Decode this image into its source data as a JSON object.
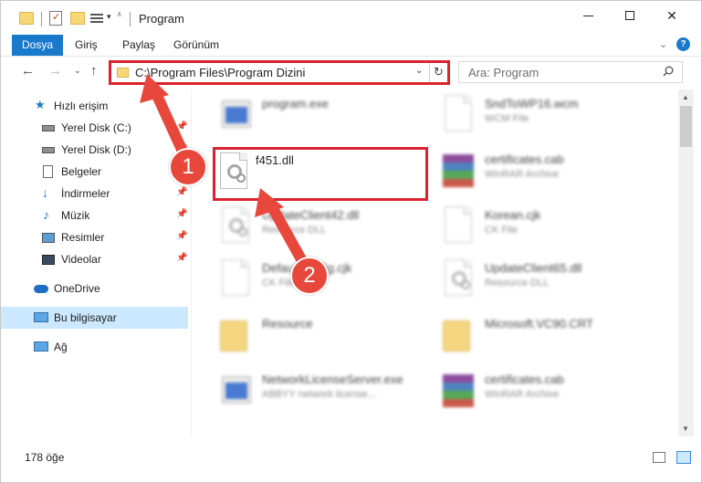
{
  "window": {
    "title": "Program"
  },
  "ribbon": {
    "tabs": [
      {
        "label": "Dosya",
        "active": true
      },
      {
        "label": "Giriş"
      },
      {
        "label": "Paylaş"
      },
      {
        "label": "Görünüm"
      }
    ],
    "help": "?"
  },
  "address": {
    "path": "C:\\Program Files\\Program Dizini",
    "refresh_icon": "refresh-icon"
  },
  "search": {
    "placeholder": "Ara: Program"
  },
  "sidebar": {
    "items": [
      {
        "label": "Hızlı erişim",
        "icon": "star-icon"
      },
      {
        "label": "Yerel Disk (C:)",
        "icon": "drive-icon",
        "pinned": true
      },
      {
        "label": "Yerel Disk (D:)",
        "icon": "drive-icon",
        "pinned": true
      },
      {
        "label": "Belgeler",
        "icon": "documents-icon",
        "pinned": true
      },
      {
        "label": "İndirmeler",
        "icon": "download-icon",
        "pinned": true
      },
      {
        "label": "Müzik",
        "icon": "music-icon",
        "pinned": true
      },
      {
        "label": "Resimler",
        "icon": "pictures-icon",
        "pinned": true
      },
      {
        "label": "Videolar",
        "icon": "videos-icon",
        "pinned": true
      },
      {
        "label": "OneDrive",
        "icon": "cloud-icon"
      },
      {
        "label": "Bu bilgisayar",
        "icon": "computer-icon",
        "selected": true
      },
      {
        "label": "Ağ",
        "icon": "network-icon"
      }
    ]
  },
  "files": {
    "left": [
      {
        "name": "program.exe",
        "desc": "",
        "type": "exe"
      },
      {
        "name": "f451.dll",
        "desc": "",
        "type": "dll",
        "highlighted": true
      },
      {
        "name": "UpdateClient42.dll",
        "desc": "Resource DLL",
        "type": "dll"
      },
      {
        "name": "DefaultConfig.cjk",
        "desc": "CK File",
        "type": "doc"
      },
      {
        "name": "Resource",
        "desc": "",
        "type": "folder"
      },
      {
        "name": "NetworkLicenseServer.exe",
        "desc": "ABBYY network license...",
        "type": "exe"
      }
    ],
    "right": [
      {
        "name": "SndToWP16.wcm",
        "desc": "WCM File",
        "type": "doc"
      },
      {
        "name": "certificates.cab",
        "desc": "WinRAR Archive",
        "type": "rar"
      },
      {
        "name": "Korean.cjk",
        "desc": "CK File",
        "type": "doc"
      },
      {
        "name": "UpdateClient65.dll",
        "desc": "Resource DLL",
        "type": "dll"
      },
      {
        "name": "Microsoft.VC90.CRT",
        "desc": "",
        "type": "folder"
      },
      {
        "name": "certificates.cab",
        "desc": "WinRAR Archive",
        "type": "rar"
      }
    ]
  },
  "status": {
    "count": "178 öğe"
  },
  "annotations": {
    "badge1": "1",
    "badge2": "2",
    "color": "#e8473b"
  },
  "colors": {
    "accent": "#1979ca",
    "highlight_border": "#d9232e",
    "selected_bg": "#cce8ff"
  }
}
